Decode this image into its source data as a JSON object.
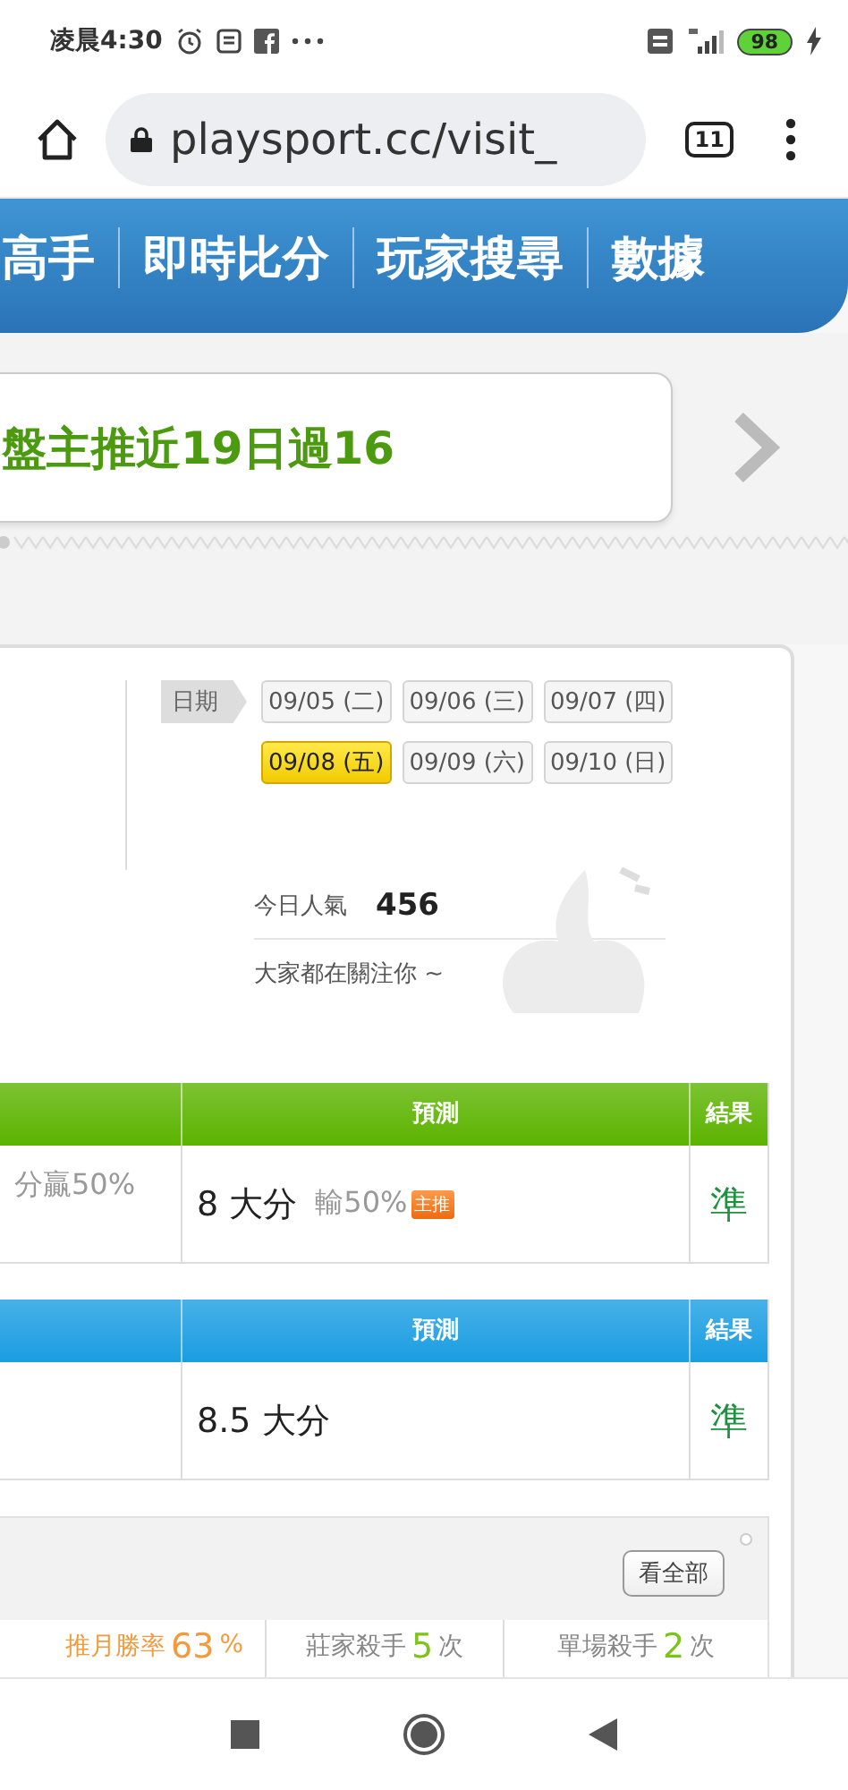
{
  "status_bar": {
    "time": "凌晨4:30",
    "battery": "98"
  },
  "browser": {
    "url": "playsport.cc/visit_",
    "tab_count": "11"
  },
  "nav": {
    "items": [
      "高手",
      "即時比分",
      "玩家搜尋",
      "數據"
    ]
  },
  "banner": {
    "text": "盤主推近19日過16"
  },
  "dates": {
    "label": "日期",
    "items": [
      {
        "label": "09/05 (二)",
        "selected": false
      },
      {
        "label": "09/06 (三)",
        "selected": false
      },
      {
        "label": "09/07 (四)",
        "selected": false
      },
      {
        "label": "09/08 (五)",
        "selected": true
      },
      {
        "label": "09/09 (六)",
        "selected": false
      },
      {
        "label": "09/10 (日)",
        "selected": false
      }
    ]
  },
  "popularity": {
    "label": "今日人氣",
    "value": "456",
    "note": "大家都在關注你 ~"
  },
  "tables": [
    {
      "color": "#5cb300",
      "headers": [
        "預測",
        "結果"
      ],
      "column_1": "分贏50%",
      "prediction": "8 大分",
      "odds": "輸50%",
      "badge": "主推",
      "result": "準"
    },
    {
      "color": "#1a9de2",
      "headers": [
        "預測",
        "結果"
      ],
      "prediction": "8.5 大分",
      "result": "準"
    }
  ],
  "summary": {
    "button": "看全部",
    "stats": [
      {
        "label": "推月勝率",
        "value": "63",
        "unit": "%",
        "highlight": true
      },
      {
        "label": "莊家殺手",
        "value": "5",
        "unit": "次",
        "highlight": false
      },
      {
        "label": "單場殺手",
        "value": "2",
        "unit": "次",
        "highlight": false
      }
    ]
  }
}
